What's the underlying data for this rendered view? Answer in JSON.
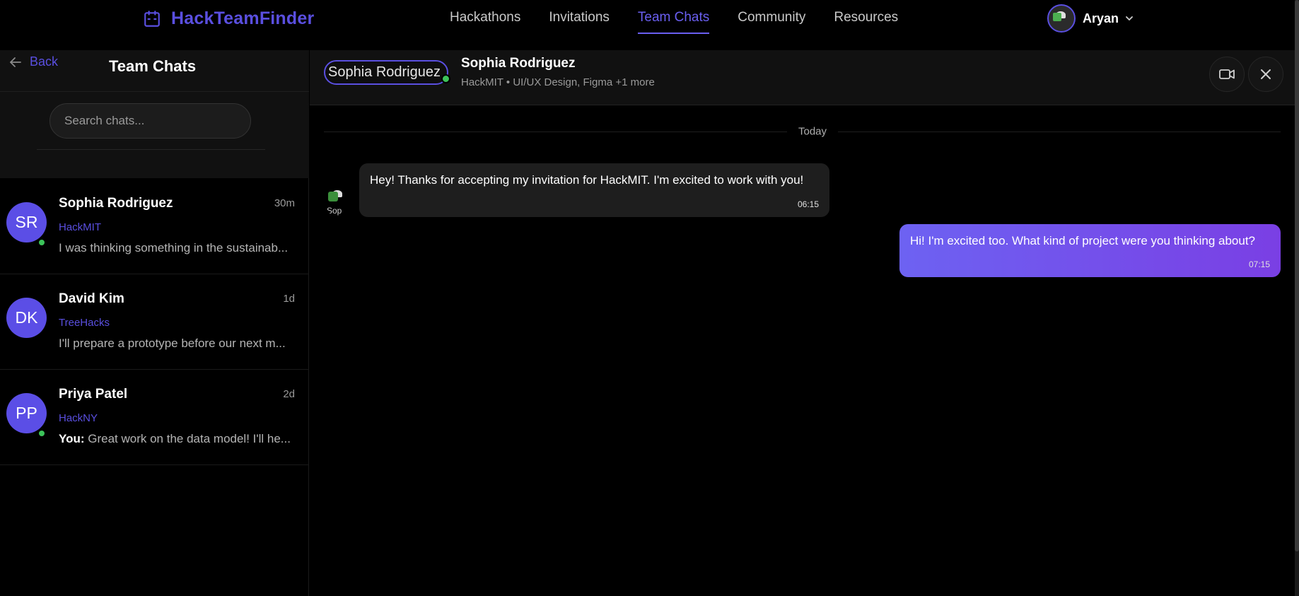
{
  "app": {
    "brand": "HackTeamFinder",
    "accent": "#5a4fe0"
  },
  "nav": {
    "links": [
      "Hackathons",
      "Invitations",
      "Team Chats",
      "Community",
      "Resources"
    ],
    "active": "Team Chats"
  },
  "user": {
    "name": "Aryan"
  },
  "sidebar": {
    "back_label": "Back",
    "title": "Team Chats",
    "search_placeholder": "Search chats...",
    "chats": [
      {
        "initials": "SR",
        "name": "Sophia Rodriguez",
        "time": "30m",
        "event": "HackMIT",
        "preview": "I was thinking something in the sustainab...",
        "preview_prefix": "",
        "online": true
      },
      {
        "initials": "DK",
        "name": "David Kim",
        "time": "1d",
        "event": "TreeHacks",
        "preview": "I'll prepare a prototype before our next m...",
        "preview_prefix": "",
        "online": false
      },
      {
        "initials": "PP",
        "name": "Priya Patel",
        "time": "2d",
        "event": "HackNY",
        "preview": "Great work on the data model! I'll he...",
        "preview_prefix": "You:",
        "online": true
      }
    ]
  },
  "conversation": {
    "avatar_alt": "Sophia Rodriguez",
    "name": "Sophia Rodriguez",
    "subtitle": "HackMIT • UI/UX Design, Figma +1 more",
    "date_label": "Today",
    "incoming_avatar_alt": "Sop",
    "messages": [
      {
        "direction": "in",
        "text": "Hey! Thanks for accepting my invitation for HackMIT. I'm excited to work with you!",
        "time": "06:15"
      },
      {
        "direction": "out",
        "text": "Hi! I'm excited too. What kind of project were you thinking about?",
        "time": "07:15"
      }
    ]
  },
  "icons": {
    "brand": "calendar-icon",
    "back": "arrow-left-icon",
    "user_menu": "chevron-down-icon",
    "video": "video-camera-icon",
    "close": "close-icon"
  }
}
